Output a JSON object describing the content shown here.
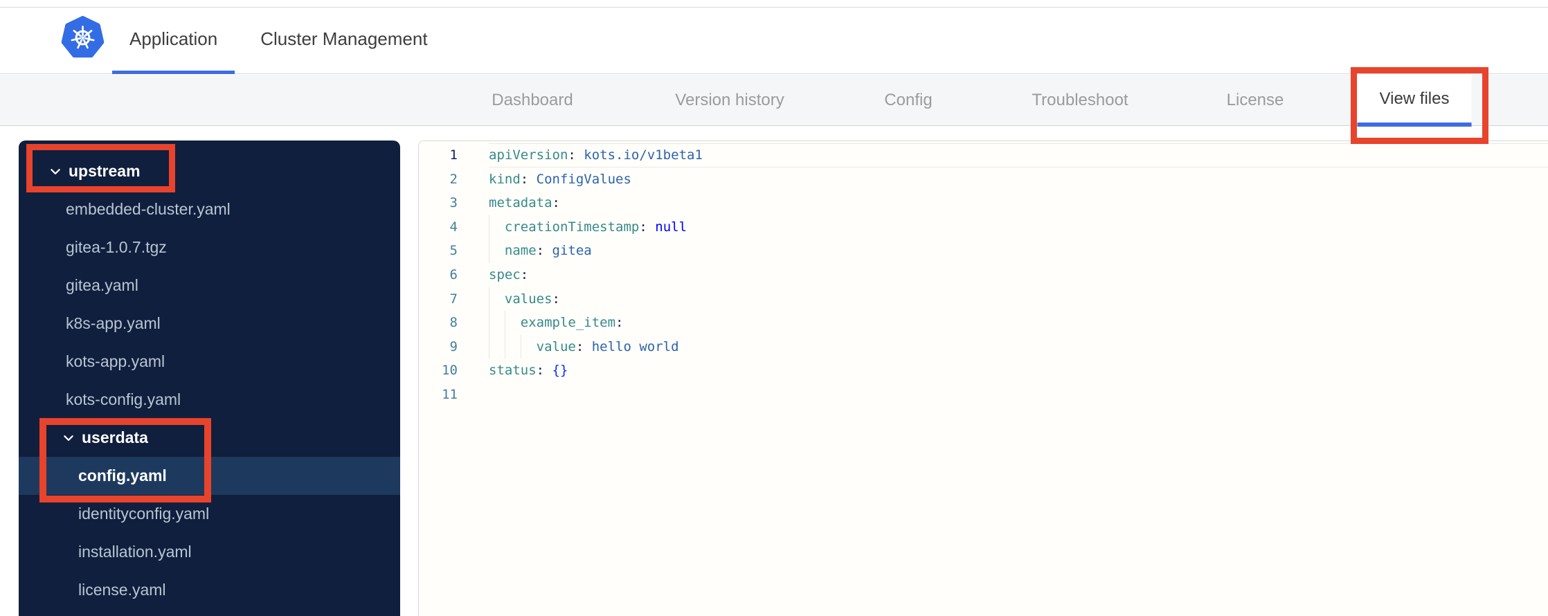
{
  "header": {
    "logo_name": "kubernetes-logo",
    "tabs": [
      {
        "label": "Application",
        "active": true
      },
      {
        "label": "Cluster Management",
        "active": false
      }
    ]
  },
  "subnav": {
    "tabs": [
      {
        "label": "Dashboard",
        "active": false
      },
      {
        "label": "Version history",
        "active": false
      },
      {
        "label": "Config",
        "active": false
      },
      {
        "label": "Troubleshoot",
        "active": false
      },
      {
        "label": "License",
        "active": false
      },
      {
        "label": "View files",
        "active": true
      }
    ]
  },
  "file_tree": {
    "items": [
      {
        "type": "folder",
        "label": "upstream",
        "depth": 0,
        "expanded": true
      },
      {
        "type": "file",
        "label": "embedded-cluster.yaml",
        "depth": 1
      },
      {
        "type": "file",
        "label": "gitea-1.0.7.tgz",
        "depth": 1
      },
      {
        "type": "file",
        "label": "gitea.yaml",
        "depth": 1
      },
      {
        "type": "file",
        "label": "k8s-app.yaml",
        "depth": 1
      },
      {
        "type": "file",
        "label": "kots-app.yaml",
        "depth": 1
      },
      {
        "type": "file",
        "label": "kots-config.yaml",
        "depth": 1
      },
      {
        "type": "folder",
        "label": "userdata",
        "depth": 1,
        "expanded": true
      },
      {
        "type": "file",
        "label": "config.yaml",
        "depth": 2,
        "selected": true
      },
      {
        "type": "file",
        "label": "identityconfig.yaml",
        "depth": 2
      },
      {
        "type": "file",
        "label": "installation.yaml",
        "depth": 2
      },
      {
        "type": "file",
        "label": "license.yaml",
        "depth": 2
      }
    ]
  },
  "editor": {
    "language": "yaml",
    "lines": [
      {
        "n": 1,
        "indent": 0,
        "active": true,
        "segs": [
          [
            "key",
            "apiVersion"
          ],
          [
            "pun",
            ":"
          ],
          [
            "pln",
            " "
          ],
          [
            "val",
            "kots.io/v1beta1"
          ]
        ]
      },
      {
        "n": 2,
        "indent": 0,
        "segs": [
          [
            "key",
            "kind"
          ],
          [
            "pun",
            ":"
          ],
          [
            "pln",
            " "
          ],
          [
            "val",
            "ConfigValues"
          ]
        ]
      },
      {
        "n": 3,
        "indent": 0,
        "segs": [
          [
            "key",
            "metadata"
          ],
          [
            "pun",
            ":"
          ]
        ]
      },
      {
        "n": 4,
        "indent": 2,
        "segs": [
          [
            "key",
            "creationTimestamp"
          ],
          [
            "pun",
            ":"
          ],
          [
            "pln",
            " "
          ],
          [
            "kw",
            "null"
          ]
        ]
      },
      {
        "n": 5,
        "indent": 2,
        "segs": [
          [
            "key",
            "name"
          ],
          [
            "pun",
            ":"
          ],
          [
            "pln",
            " "
          ],
          [
            "val",
            "gitea"
          ]
        ]
      },
      {
        "n": 6,
        "indent": 0,
        "segs": [
          [
            "key",
            "spec"
          ],
          [
            "pun",
            ":"
          ]
        ]
      },
      {
        "n": 7,
        "indent": 2,
        "segs": [
          [
            "key",
            "values"
          ],
          [
            "pun",
            ":"
          ]
        ]
      },
      {
        "n": 8,
        "indent": 4,
        "segs": [
          [
            "key",
            "example_item"
          ],
          [
            "pun",
            ":"
          ]
        ]
      },
      {
        "n": 9,
        "indent": 6,
        "segs": [
          [
            "key",
            "value"
          ],
          [
            "pun",
            ":"
          ],
          [
            "pln",
            " "
          ],
          [
            "val",
            "hello world"
          ]
        ]
      },
      {
        "n": 10,
        "indent": 0,
        "segs": [
          [
            "key",
            "status"
          ],
          [
            "pun",
            ":"
          ],
          [
            "pln",
            " "
          ],
          [
            "brk",
            "{}"
          ]
        ]
      },
      {
        "n": 11,
        "indent": 0,
        "segs": []
      }
    ]
  },
  "annotations": {
    "box_color": "#e8432c",
    "targets": [
      "upstream folder",
      "userdata folder and config.yaml file",
      "View files tab"
    ]
  },
  "colors": {
    "accent_blue": "#3f6ce0",
    "kubernetes_blue": "#336ce5",
    "sidebar_bg": "#101f3d",
    "sidebar_selected_bg": "#1d3a5e",
    "subnav_bg": "#f5f6f8",
    "yaml_key": "#348a8a",
    "yaml_value": "#2b63ad",
    "yaml_keyword": "#0000ff",
    "line_number": "#437e9d",
    "active_line_number": "#0b216f"
  }
}
